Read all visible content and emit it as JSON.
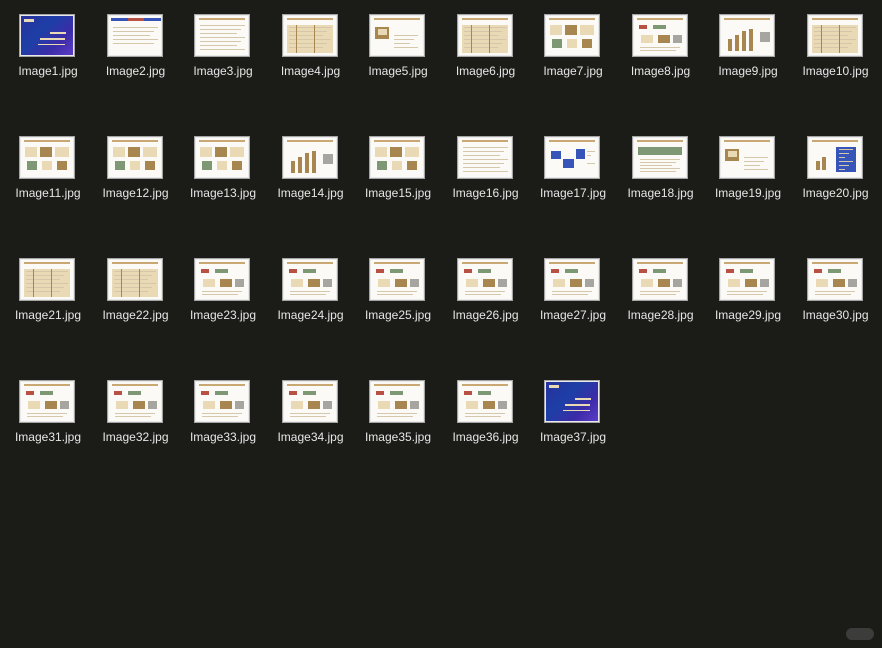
{
  "files": [
    {
      "name": "Image1.jpg",
      "icon": "image-icon",
      "style": "blue"
    },
    {
      "name": "Image2.jpg",
      "icon": "image-icon",
      "style": "cover"
    },
    {
      "name": "Image3.jpg",
      "icon": "image-icon",
      "style": "text"
    },
    {
      "name": "Image4.jpg",
      "icon": "image-icon",
      "style": "table"
    },
    {
      "name": "Image5.jpg",
      "icon": "image-icon",
      "style": "illustration"
    },
    {
      "name": "Image6.jpg",
      "icon": "image-icon",
      "style": "table"
    },
    {
      "name": "Image7.jpg",
      "icon": "image-icon",
      "style": "cards"
    },
    {
      "name": "Image8.jpg",
      "icon": "image-icon",
      "style": "flow"
    },
    {
      "name": "Image9.jpg",
      "icon": "image-icon",
      "style": "chart"
    },
    {
      "name": "Image10.jpg",
      "icon": "image-icon",
      "style": "table"
    },
    {
      "name": "Image11.jpg",
      "icon": "image-icon",
      "style": "cards"
    },
    {
      "name": "Image12.jpg",
      "icon": "image-icon",
      "style": "cards"
    },
    {
      "name": "Image13.jpg",
      "icon": "image-icon",
      "style": "cards"
    },
    {
      "name": "Image14.jpg",
      "icon": "image-icon",
      "style": "chart"
    },
    {
      "name": "Image15.jpg",
      "icon": "image-icon",
      "style": "cards"
    },
    {
      "name": "Image16.jpg",
      "icon": "image-icon",
      "style": "text"
    },
    {
      "name": "Image17.jpg",
      "icon": "image-icon",
      "style": "bluegraph"
    },
    {
      "name": "Image18.jpg",
      "icon": "image-icon",
      "style": "green"
    },
    {
      "name": "Image19.jpg",
      "icon": "image-icon",
      "style": "illustration"
    },
    {
      "name": "Image20.jpg",
      "icon": "image-icon",
      "style": "bluechart"
    },
    {
      "name": "Image21.jpg",
      "icon": "image-icon",
      "style": "table"
    },
    {
      "name": "Image22.jpg",
      "icon": "image-icon",
      "style": "table"
    },
    {
      "name": "Image23.jpg",
      "icon": "image-icon",
      "style": "flow"
    },
    {
      "name": "Image24.jpg",
      "icon": "image-icon",
      "style": "flow"
    },
    {
      "name": "Image25.jpg",
      "icon": "image-icon",
      "style": "flow"
    },
    {
      "name": "Image26.jpg",
      "icon": "image-icon",
      "style": "flow"
    },
    {
      "name": "Image27.jpg",
      "icon": "image-icon",
      "style": "flow"
    },
    {
      "name": "Image28.jpg",
      "icon": "image-icon",
      "style": "flow"
    },
    {
      "name": "Image29.jpg",
      "icon": "image-icon",
      "style": "flow"
    },
    {
      "name": "Image30.jpg",
      "icon": "image-icon",
      "style": "flow"
    },
    {
      "name": "Image31.jpg",
      "icon": "image-icon",
      "style": "flow"
    },
    {
      "name": "Image32.jpg",
      "icon": "image-icon",
      "style": "flow"
    },
    {
      "name": "Image33.jpg",
      "icon": "image-icon",
      "style": "flow"
    },
    {
      "name": "Image34.jpg",
      "icon": "image-icon",
      "style": "flow"
    },
    {
      "name": "Image35.jpg",
      "icon": "image-icon",
      "style": "flow"
    },
    {
      "name": "Image36.jpg",
      "icon": "image-icon",
      "style": "flow"
    },
    {
      "name": "Image37.jpg",
      "icon": "image-icon",
      "style": "blue"
    }
  ],
  "watermark": {
    "icon": "watermark-icon"
  },
  "colors": {
    "background": "#1b1b18",
    "label": "#e6e6e6",
    "thumb_border": "#a5a5a5",
    "slide_bg": "#fbfaf7",
    "accent": "#c9a873",
    "blue": "#29309c"
  }
}
